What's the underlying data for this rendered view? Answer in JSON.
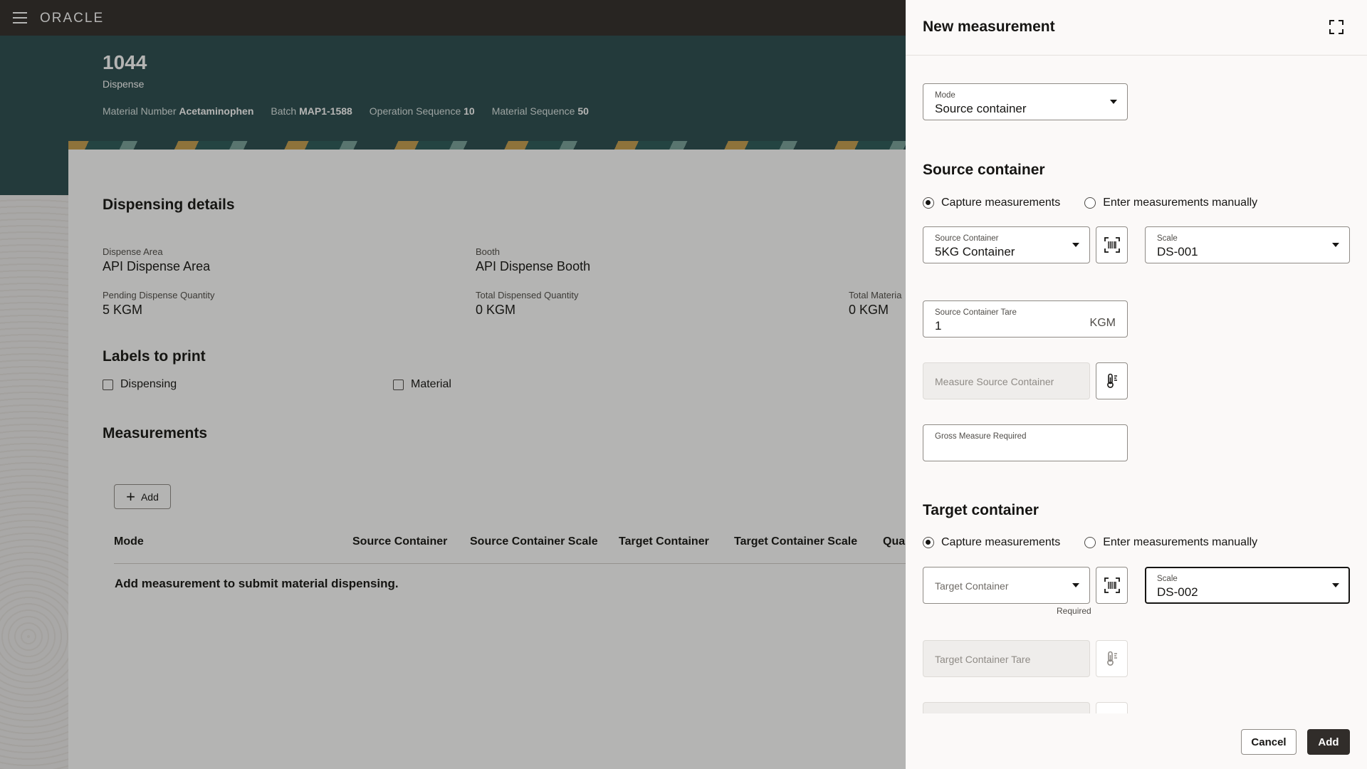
{
  "header": {
    "logo": "ORACLE"
  },
  "record": {
    "id": "1044",
    "type": "Dispense",
    "meta": [
      {
        "label": "Material Number",
        "value": "Acetaminophen"
      },
      {
        "label": "Batch",
        "value": "MAP1-1588"
      },
      {
        "label": "Operation Sequence",
        "value": "10"
      },
      {
        "label": "Material Sequence",
        "value": "50"
      }
    ]
  },
  "details": {
    "title": "Dispensing details",
    "dispense_area_label": "Dispense Area",
    "dispense_area_value": "API Dispense Area",
    "booth_label": "Booth",
    "booth_value": "API Dispense Booth",
    "pending_label": "Pending Dispense Quantity",
    "pending_value": "5 KGM",
    "total_dispensed_label": "Total Dispensed Quantity",
    "total_dispensed_value": "0 KGM",
    "total_material_label": "Total Materia",
    "total_material_value": "0 KGM"
  },
  "labels": {
    "title": "Labels to print",
    "dispensing": "Dispensing",
    "material": "Material"
  },
  "measurements": {
    "title": "Measurements",
    "add_label": "Add",
    "columns": [
      "Mode",
      "Source Container",
      "Source Container Scale",
      "Target Container",
      "Target Container Scale",
      "Qua"
    ],
    "empty_message": "Add measurement to submit material dispensing."
  },
  "drawer": {
    "title": "New measurement",
    "mode": {
      "label": "Mode",
      "value": "Source container"
    },
    "source": {
      "title": "Source container",
      "radio_capture": "Capture measurements",
      "radio_manual": "Enter measurements manually",
      "container_label": "Source Container",
      "container_value": "5KG Container",
      "scale_label": "Scale",
      "scale_value": "DS-001",
      "tare_label": "Source Container Tare",
      "tare_value": "1",
      "tare_unit": "KGM",
      "measure_placeholder": "Measure Source Container",
      "gross_label": "Gross Measure Required"
    },
    "target": {
      "title": "Target container",
      "radio_capture": "Capture measurements",
      "radio_manual": "Enter measurements manually",
      "container_placeholder": "Target Container",
      "required_hint": "Required",
      "scale_label": "Scale",
      "scale_value": "DS-002",
      "tare_placeholder": "Target Container Tare"
    },
    "cancel_label": "Cancel",
    "add_label": "Add"
  }
}
